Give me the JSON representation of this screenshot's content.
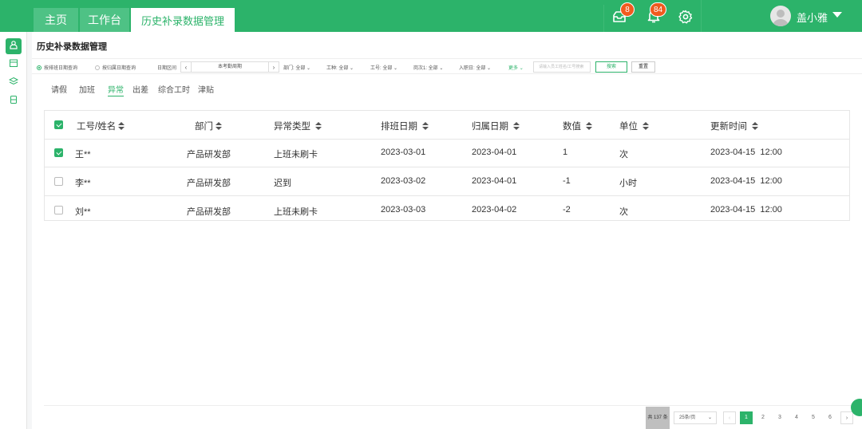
{
  "topbar": {
    "tabs": [
      {
        "label": "主页"
      },
      {
        "label": "工作台"
      },
      {
        "label": "历史补录数据管理"
      }
    ],
    "messages_badge": "8",
    "notifications_badge": "84",
    "username": "盖小雅",
    "brand_color": "#2cb36a"
  },
  "page": {
    "title": "历史补录数据管理"
  },
  "filters": {
    "radio_by_schedule": "按排班日期查询",
    "radio_by_belong": "按归属日期查询",
    "date_range_label": "日期区间",
    "date_range_value": "本考勤周期",
    "dept": "部门: 全部",
    "worktype": "工种: 全部",
    "workno": "工号: 全部",
    "post": "岗次1: 全部",
    "joindate": "入职日: 全部",
    "more": "更多",
    "search_placeholder": "请输入员工姓名/工号搜索",
    "search_button": "搜索",
    "reset_button": "重置"
  },
  "subtabs": [
    "请假",
    "加班",
    "异常",
    "出差",
    "综合工时",
    "津贴"
  ],
  "table": {
    "headers": [
      "工号/姓名",
      "部门",
      "异常类型",
      "排班日期",
      "归属日期",
      "数值",
      "单位",
      "更新时间"
    ],
    "rows": [
      {
        "checked": true,
        "name": "王**",
        "dept": "产品研发部",
        "type": "上班未刷卡",
        "schedule": "2023-03-01",
        "belong": "2023-04-01",
        "value": "1",
        "unit": "次",
        "updated": "2023-04-15  12:00"
      },
      {
        "checked": false,
        "name": "李**",
        "dept": "产品研发部",
        "type": "迟到",
        "schedule": "2023-03-02",
        "belong": "2023-04-01",
        "value": "-1",
        "unit": "小时",
        "updated": "2023-04-15  12:00"
      },
      {
        "checked": false,
        "name": "刘**",
        "dept": "产品研发部",
        "type": "上班未刷卡",
        "schedule": "2023-03-03",
        "belong": "2023-04-02",
        "value": "-2",
        "unit": "次",
        "updated": "2023-04-15  12:00"
      }
    ]
  },
  "pagination": {
    "total": "共 137 条",
    "page_size": "25条/页",
    "pages": [
      "1",
      "2",
      "3",
      "4",
      "5",
      "6"
    ]
  }
}
